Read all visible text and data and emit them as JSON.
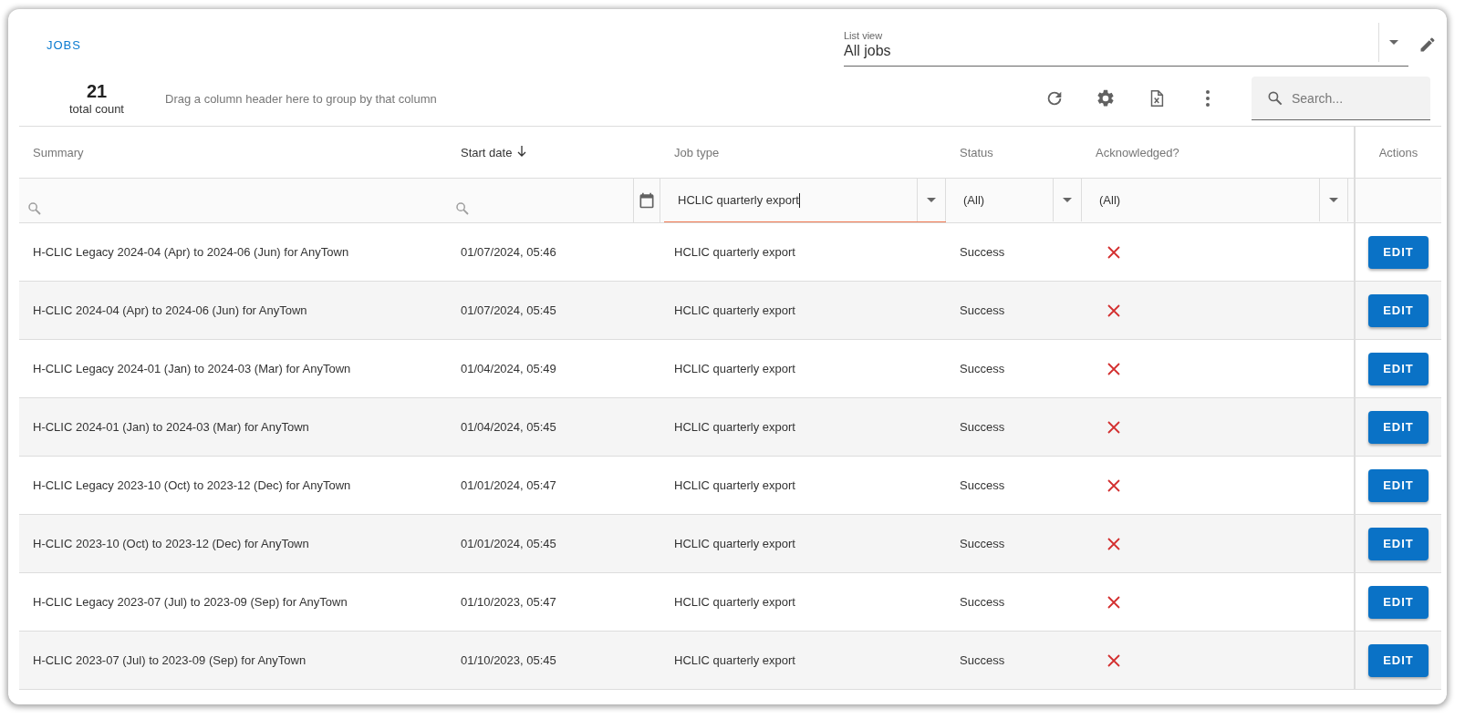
{
  "header": {
    "title": "JOBS"
  },
  "list_view": {
    "label": "List view",
    "value": "All jobs"
  },
  "total": {
    "count": "21",
    "label": "total count"
  },
  "group_hint": "Drag a column header here to group by that column",
  "search": {
    "placeholder": "Search..."
  },
  "columns": [
    {
      "label": "Summary",
      "sorted": false
    },
    {
      "label": "Start date",
      "sorted": true
    },
    {
      "label": "Job type",
      "sorted": false
    },
    {
      "label": "Status",
      "sorted": false
    },
    {
      "label": "Acknowledged?",
      "sorted": false
    },
    {
      "label": "Actions",
      "sorted": false
    }
  ],
  "filters": [
    {
      "kind": "search"
    },
    {
      "kind": "date"
    },
    {
      "kind": "select",
      "value": "HCLIC quarterly export",
      "focused": true
    },
    {
      "kind": "select",
      "value": "(All)",
      "focused": false
    },
    {
      "kind": "select",
      "value": "(All)",
      "focused": false
    },
    {
      "kind": "empty"
    }
  ],
  "rows": [
    {
      "summary": "H-CLIC Legacy 2024-04 (Apr) to 2024-06 (Jun) for AnyTown",
      "start_date": "01/07/2024, 05:46",
      "job_type": "HCLIC quarterly export",
      "status": "Success",
      "acknowledged": false,
      "action": "EDIT"
    },
    {
      "summary": "H-CLIC 2024-04 (Apr) to 2024-06 (Jun) for AnyTown",
      "start_date": "01/07/2024, 05:45",
      "job_type": "HCLIC quarterly export",
      "status": "Success",
      "acknowledged": false,
      "action": "EDIT"
    },
    {
      "summary": "H-CLIC Legacy 2024-01 (Jan) to 2024-03 (Mar) for AnyTown",
      "start_date": "01/04/2024, 05:49",
      "job_type": "HCLIC quarterly export",
      "status": "Success",
      "acknowledged": false,
      "action": "EDIT"
    },
    {
      "summary": "H-CLIC 2024-01 (Jan) to 2024-03 (Mar) for AnyTown",
      "start_date": "01/04/2024, 05:45",
      "job_type": "HCLIC quarterly export",
      "status": "Success",
      "acknowledged": false,
      "action": "EDIT"
    },
    {
      "summary": "H-CLIC Legacy 2023-10 (Oct) to 2023-12 (Dec) for AnyTown",
      "start_date": "01/01/2024, 05:47",
      "job_type": "HCLIC quarterly export",
      "status": "Success",
      "acknowledged": false,
      "action": "EDIT"
    },
    {
      "summary": "H-CLIC 2023-10 (Oct) to 2023-12 (Dec) for AnyTown",
      "start_date": "01/01/2024, 05:45",
      "job_type": "HCLIC quarterly export",
      "status": "Success",
      "acknowledged": false,
      "action": "EDIT"
    },
    {
      "summary": "H-CLIC Legacy 2023-07 (Jul) to 2023-09 (Sep) for AnyTown",
      "start_date": "01/10/2023, 05:47",
      "job_type": "HCLIC quarterly export",
      "status": "Success",
      "acknowledged": false,
      "action": "EDIT"
    },
    {
      "summary": "H-CLIC 2023-07 (Jul) to 2023-09 (Sep) for AnyTown",
      "start_date": "01/10/2023, 05:45",
      "job_type": "HCLIC quarterly export",
      "status": "Success",
      "acknowledged": false,
      "action": "EDIT"
    }
  ]
}
